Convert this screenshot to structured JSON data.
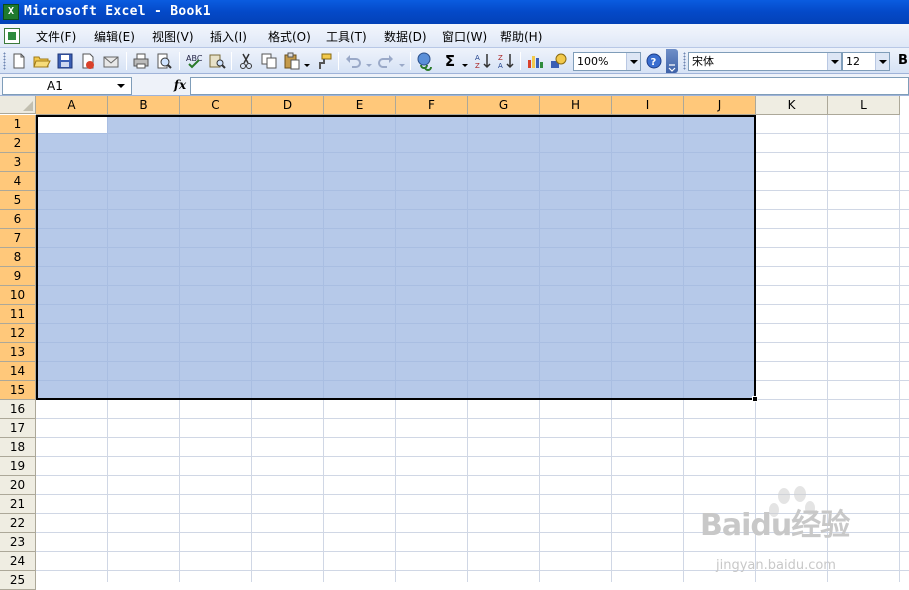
{
  "window": {
    "title": "Microsoft Excel - Book1"
  },
  "menu": [
    {
      "label": "文件(F)"
    },
    {
      "label": "编辑(E)"
    },
    {
      "label": "视图(V)"
    },
    {
      "label": "插入(I)"
    },
    {
      "label": "格式(O)"
    },
    {
      "label": "工具(T)"
    },
    {
      "label": "数据(D)"
    },
    {
      "label": "窗口(W)"
    },
    {
      "label": "帮助(H)"
    }
  ],
  "toolbar": {
    "zoom": "100%",
    "font_name": "宋体",
    "font_size": "12",
    "sum_symbol": "Σ",
    "bold_label": "B",
    "icons": [
      "new-icon",
      "open-icon",
      "save-icon",
      "permission-icon",
      "print-icon",
      "print-preview-icon",
      "spelling-icon",
      "research-icon",
      "cut-icon",
      "copy-icon",
      "paste-icon",
      "format-painter-icon",
      "undo-icon",
      "redo-icon",
      "hyperlink-icon",
      "autosum-icon",
      "sort-ascending-icon",
      "sort-descending-icon",
      "chart-wizard-icon",
      "drawing-icon",
      "help-icon"
    ]
  },
  "formula_bar": {
    "name_box": "A1",
    "fx": "fx",
    "value": ""
  },
  "sheet": {
    "columns": [
      "A",
      "B",
      "C",
      "D",
      "E",
      "F",
      "G",
      "H",
      "I",
      "J",
      "K",
      "L"
    ],
    "rows": [
      "1",
      "2",
      "3",
      "4",
      "5",
      "6",
      "7",
      "8",
      "9",
      "10",
      "11",
      "12",
      "13",
      "14",
      "15",
      "16",
      "17",
      "18",
      "19",
      "20",
      "21",
      "22",
      "23",
      "24",
      "25"
    ],
    "selection": {
      "range": "A1:J15",
      "active_cell": "A1"
    },
    "colors": {
      "selected_header": "#ffc87a",
      "selection_fill": "#b4c8e8"
    }
  },
  "watermark": {
    "brand": "Baidu经验",
    "url": "jingyan.baidu.com"
  }
}
